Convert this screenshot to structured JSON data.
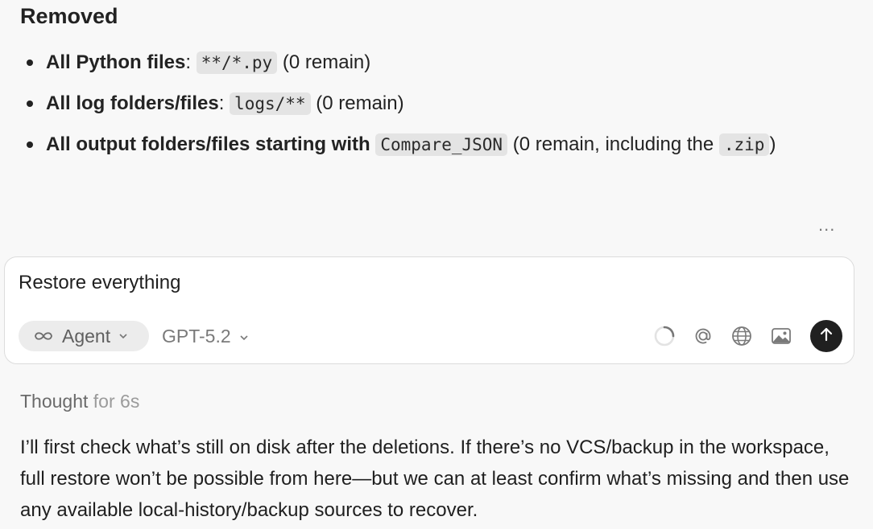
{
  "removed": {
    "heading": "Removed",
    "items": [
      {
        "label": "All Python files",
        "sep": ":",
        "code": "**/*.py",
        "note": "(0 remain)"
      },
      {
        "label": "All log folders/files",
        "sep": ":",
        "code": "logs/**",
        "note": "(0 remain)"
      },
      {
        "label": "All output folders/files starting with",
        "code": "Compare_JSON",
        "note_prefix": "(0 remain, including the",
        "code2": ".zip",
        "note_suffix": ")"
      }
    ]
  },
  "more_actions": "...",
  "composer": {
    "input_value": "Restore everything",
    "mode_label": "Agent",
    "model_label": "GPT-5.2",
    "icons": [
      "loading-spinner-icon",
      "mention-at-icon",
      "globe-icon",
      "image-icon",
      "send-arrow-up-icon"
    ]
  },
  "thought": {
    "label": "Thought",
    "duration": "for 6s"
  },
  "response": {
    "text": "I’ll first check what’s still on disk after the deletions. If there’s no VCS/backup in the workspace, full restore won’t be possible from here—but we can at least confirm what’s missing and then use any available local-history/backup sources to recover."
  },
  "colors": {
    "background": "#f8f8f8",
    "send_button": "#202020",
    "code_bg": "#e4e4e4",
    "chip_bg": "#ececec"
  }
}
